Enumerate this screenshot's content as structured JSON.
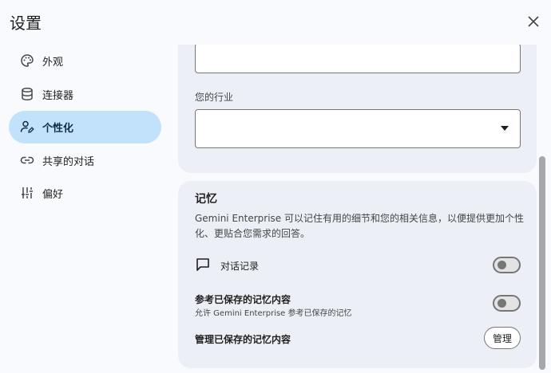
{
  "dialog": {
    "title": "设置",
    "close_icon": "close-icon"
  },
  "sidebar": {
    "items": [
      {
        "label": "外观",
        "icon": "palette-icon"
      },
      {
        "label": "连接器",
        "icon": "database-icon"
      },
      {
        "label": "个性化",
        "icon": "person-edit-icon",
        "active": true
      },
      {
        "label": "共享的对话",
        "icon": "link-icon"
      },
      {
        "label": "偏好",
        "icon": "tune-icon"
      }
    ]
  },
  "profile": {
    "industry_label": "您的行业",
    "industry_value": ""
  },
  "memory": {
    "title": "记忆",
    "description": "Gemini Enterprise 可以记住有用的细节和您的相关信息，以便提供更加个性化、更贴合您需求的回答。",
    "chat_history_label": "对话记录",
    "saved_memory_label": "参考已保存的记忆内容",
    "saved_memory_sub": "允许 Gemini Enterprise 参考已保存的记忆",
    "manage_label": "管理已保存的记忆内容",
    "manage_button": "管理"
  },
  "colors": {
    "accent": "#c2e1fb",
    "background": "#f8fafd",
    "card": "#eceff5"
  }
}
